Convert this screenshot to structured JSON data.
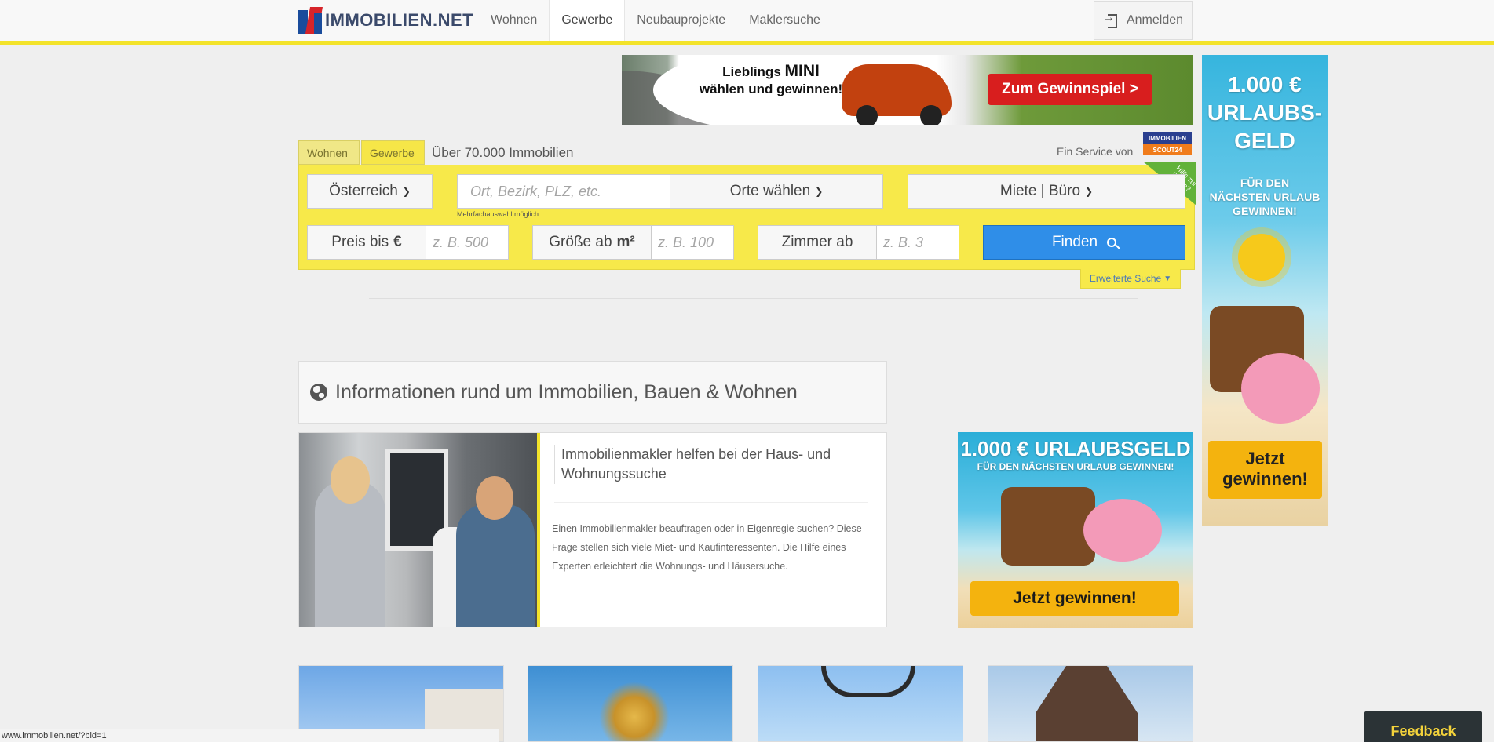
{
  "header": {
    "logo_text": "IMMOBILIEN.NET",
    "nav": [
      {
        "label": "Wohnen",
        "active": false
      },
      {
        "label": "Gewerbe",
        "active": true
      },
      {
        "label": "Neubauprojekte",
        "active": false
      },
      {
        "label": "Maklersuche",
        "active": false
      }
    ],
    "login_label": "Anmelden"
  },
  "ad_top": {
    "line1": "Lieblings",
    "line1_big": "MINI",
    "line2": "wählen und gewinnen!",
    "cta": "Zum Gewinnspiel >"
  },
  "ad_sky": {
    "title_lines": [
      "1.000 €",
      "URLAUBS-",
      "GELD"
    ],
    "sub_lines": [
      "FÜR DEN",
      "NÄCHSTEN URLAUB",
      "GEWINNEN!"
    ],
    "cta_lines": [
      "Jetzt",
      "gewinnen!"
    ]
  },
  "search": {
    "tab_wohnen": "Wohnen",
    "tab_gewerbe": "Gewerbe",
    "count_label": "Über 70.000 Immobilien",
    "service_label": "Ein Service von",
    "scout_line1": "IMMOBILIEN",
    "scout_line2": "SCOUT24",
    "help_tag": "Hilfe zur Suche?",
    "country": "Österreich",
    "location_placeholder": "Ort, Bezirk, PLZ, etc.",
    "location_hint": "Mehrfachauswahl möglich",
    "places_button": "Orte wählen",
    "type_select": "Miete | Büro",
    "price_label": "Preis bis",
    "price_unit": "€",
    "price_placeholder": "z. B. 500",
    "size_label": "Größe ab",
    "size_unit": "m²",
    "size_placeholder": "z. B. 100",
    "rooms_label": "Zimmer ab",
    "rooms_placeholder": "z. B. 3",
    "find_button": "Finden",
    "advanced_link": "Erweiterte Suche"
  },
  "info": {
    "heading": "Informationen rund um Immobilien, Bauen & Wohnen",
    "article_title": "Immobilienmakler helfen bei der Haus- und Wohnungssuche",
    "article_text": "Einen Immobilienmakler beauftragen oder in Eigenregie suchen? Diese Frage stellen sich viele Miet- und Kaufinteressenten. Die Hilfe eines Experten erleichtert die Wohnungs- und Häusersuche."
  },
  "ad_rect": {
    "title": "1.000 € URLAUBSGELD",
    "sub": "FÜR DEN NÄCHSTEN URLAUB GEWINNEN!",
    "cta": "Jetzt gewinnen!"
  },
  "status_url": "www.immobilien.net/?bid=1",
  "feedback_label": "Feedback",
  "colors": {
    "accent_yellow": "#f7e94a",
    "find_blue": "#2f8ee8",
    "ad_red": "#d81e1e",
    "ad_gold": "#f4b30e"
  }
}
